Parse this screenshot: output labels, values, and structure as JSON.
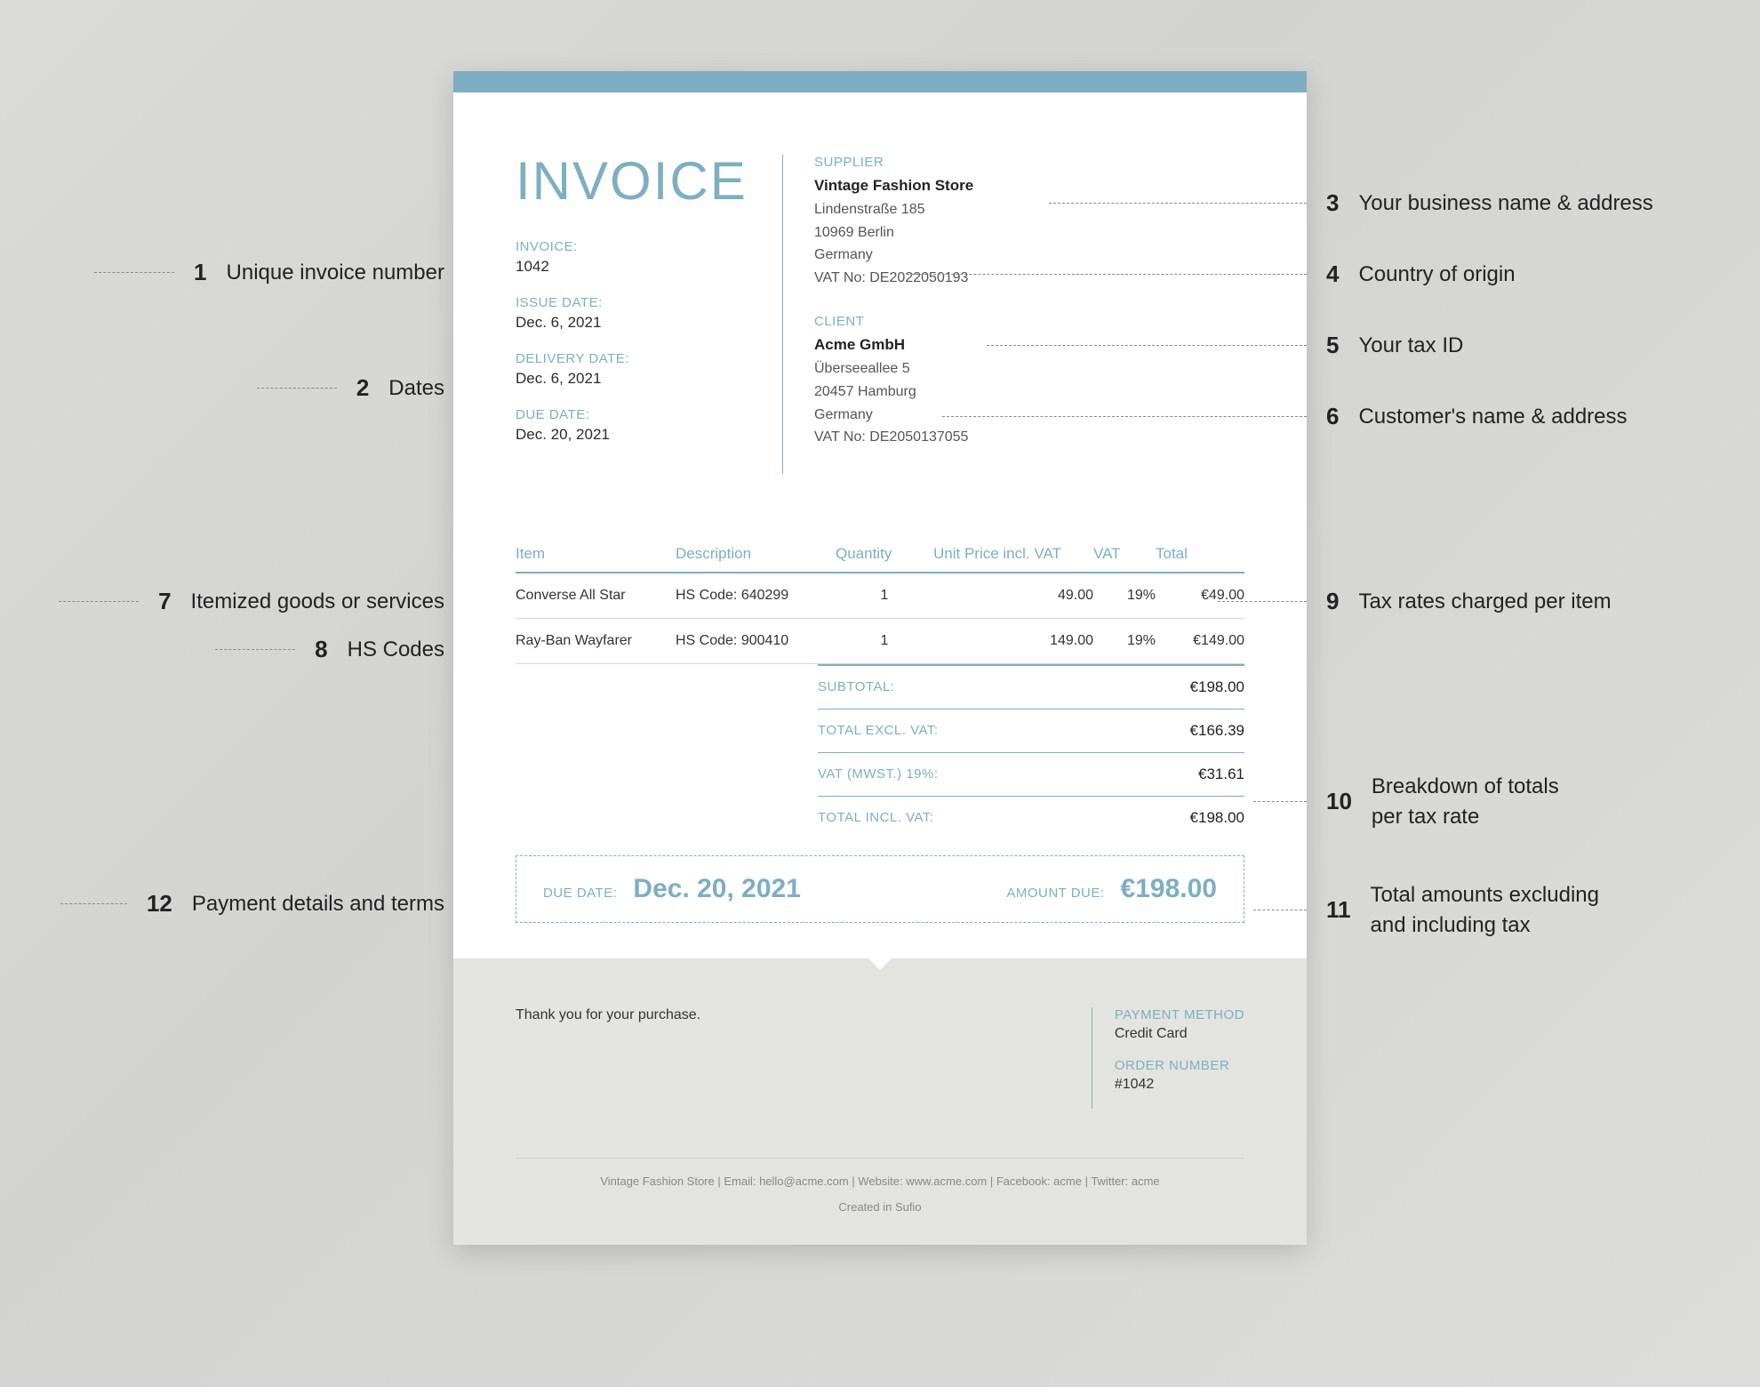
{
  "title": "INVOICE",
  "meta": {
    "invoice_label": "INVOICE:",
    "invoice_no": "1042",
    "issue_label": "ISSUE DATE:",
    "issue_date": "Dec. 6, 2021",
    "delivery_label": "DELIVERY DATE:",
    "delivery_date": "Dec. 6, 2021",
    "due_label": "DUE DATE:",
    "due_date": "Dec. 20, 2021"
  },
  "supplier": {
    "label": "SUPPLIER",
    "name": "Vintage Fashion Store",
    "street": "Lindenstraße 185",
    "city": "10969 Berlin",
    "country": "Germany",
    "vat": "VAT No: DE2022050193"
  },
  "client": {
    "label": "CLIENT",
    "name": "Acme GmbH",
    "street": "Überseeallee 5",
    "city": "20457 Hamburg",
    "country": "Germany",
    "vat": "VAT No: DE2050137055"
  },
  "cols": {
    "item": "Item",
    "desc": "Description",
    "qty": "Quantity",
    "unit": "Unit Price incl. VAT",
    "vat": "VAT",
    "total": "Total"
  },
  "items": [
    {
      "item": "Converse All Star",
      "desc": "HS Code: 640299",
      "qty": "1",
      "unit": "49.00",
      "vat": "19%",
      "total": "€49.00"
    },
    {
      "item": "Ray-Ban Wayfarer",
      "desc": "HS Code: 900410",
      "qty": "1",
      "unit": "149.00",
      "vat": "19%",
      "total": "€149.00"
    }
  ],
  "totals": {
    "subtotal_label": "SUBTOTAL:",
    "subtotal": "€198.00",
    "excl_label": "TOTAL EXCL. VAT:",
    "excl": "€166.39",
    "vat_label": "VAT (MWST.) 19%:",
    "vat": "€31.61",
    "incl_label": "TOTAL INCL. VAT:",
    "incl": "€198.00"
  },
  "due": {
    "date_label": "DUE DATE:",
    "date": "Dec. 20, 2021",
    "amount_label": "AMOUNT DUE:",
    "amount": "€198.00"
  },
  "footer": {
    "thanks": "Thank you for your purchase.",
    "pay_method_label": "PAYMENT METHOD",
    "pay_method": "Credit Card",
    "order_label": "ORDER NUMBER",
    "order": "#1042",
    "line": "Vintage Fashion Store   |   Email: hello@acme.com   |   Website: www.acme.com   |   Facebook: acme   |   Twitter: acme",
    "created": "Created in Sufio"
  },
  "annots": {
    "a1": "Unique invoice number",
    "a2": "Dates",
    "a3": "Your business name & address",
    "a4": "Country of origin",
    "a5": "Your tax ID",
    "a6": "Customer's name & address",
    "a7": "Itemized goods or services",
    "a8": "HS Codes",
    "a9": "Tax rates charged per item",
    "a10a": "Breakdown of totals",
    "a10b": "per tax rate",
    "a11a": "Total amounts excluding",
    "a11b": "and including tax",
    "a12": "Payment details and terms"
  }
}
